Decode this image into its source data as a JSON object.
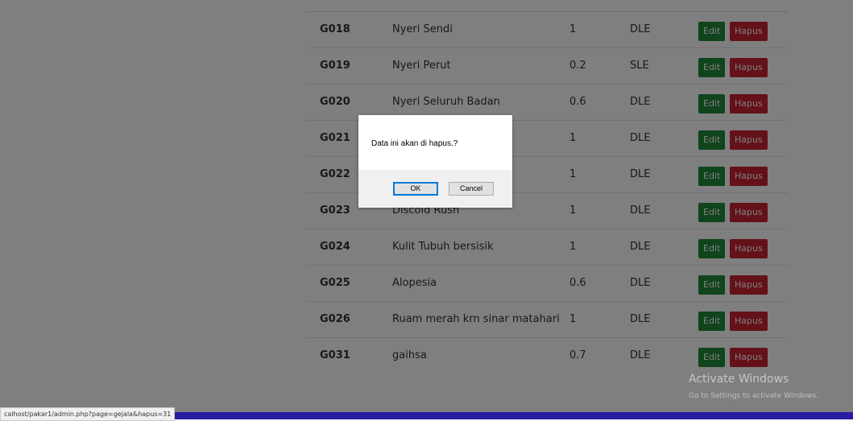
{
  "table": {
    "rows": [
      {
        "code": "G018",
        "name": "Nyeri Sendi",
        "value": "1",
        "type": "DLE"
      },
      {
        "code": "G019",
        "name": "Nyeri Perut",
        "value": "0.2",
        "type": "SLE"
      },
      {
        "code": "G020",
        "name": "Nyeri Seluruh Badan",
        "value": "0.6",
        "type": "DLE"
      },
      {
        "code": "G021",
        "name": "",
        "value": "1",
        "type": "DLE"
      },
      {
        "code": "G022",
        "name": "",
        "value": "1",
        "type": "DLE"
      },
      {
        "code": "G023",
        "name": "Discoid Rush",
        "value": "1",
        "type": "DLE"
      },
      {
        "code": "G024",
        "name": "Kulit Tubuh bersisik",
        "value": "1",
        "type": "DLE"
      },
      {
        "code": "G025",
        "name": "Alopesia",
        "value": "0.6",
        "type": "DLE"
      },
      {
        "code": "G026",
        "name": "Ruam merah krn sinar matahari",
        "value": "1",
        "type": "DLE"
      },
      {
        "code": "G031",
        "name": "gaihsa",
        "value": "0.7",
        "type": "DLE"
      }
    ],
    "edit_label": "Edit",
    "delete_label": "Hapus"
  },
  "dialog": {
    "message": "Data ini akan di hapus.?",
    "ok_label": "OK",
    "cancel_label": "Cancel"
  },
  "watermark": {
    "title": "Activate Windows",
    "subtitle": "Go to Settings to activate Windows."
  },
  "status": {
    "url": "calhost/pakar1/admin.php?page=gejala&hapus=31"
  },
  "colors": {
    "edit": "#218838",
    "delete": "#c82333",
    "taskbar": "#2a1ba0"
  }
}
